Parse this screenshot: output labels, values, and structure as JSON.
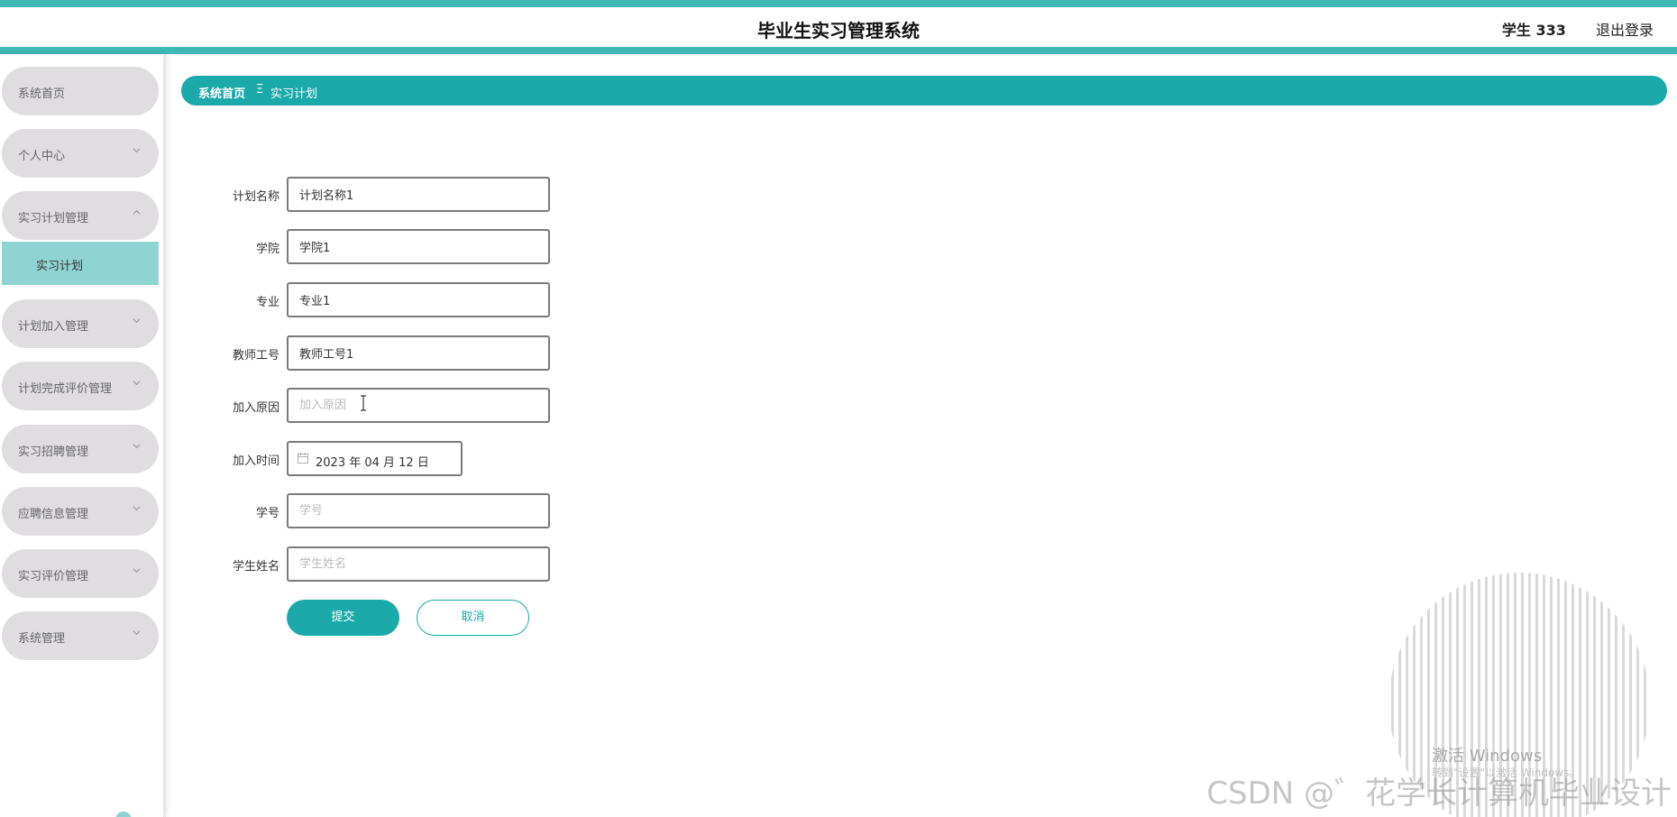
{
  "header": {
    "title": "毕业生实习管理系统",
    "user": "学生 333",
    "logout": "退出登录"
  },
  "sidebar": {
    "items": [
      {
        "label": "系统首页",
        "expandable": false
      },
      {
        "label": "个人中心",
        "expandable": true
      },
      {
        "label": "实习计划管理",
        "expandable": true,
        "expanded": true
      },
      {
        "label": "计划加入管理",
        "expandable": true
      },
      {
        "label": "计划完成评价管理",
        "expandable": true
      },
      {
        "label": "实习招聘管理",
        "expandable": true
      },
      {
        "label": "应聘信息管理",
        "expandable": true
      },
      {
        "label": "实习评价管理",
        "expandable": true
      },
      {
        "label": "系统管理",
        "expandable": true
      }
    ],
    "active_sub_item": "实习计划"
  },
  "breadcrumb": {
    "home": "系统首页",
    "separator": "Ξ",
    "current": "实习计划"
  },
  "form": {
    "fields": [
      {
        "label": "计划名称",
        "value": "计划名称1",
        "placeholder": "计划名称"
      },
      {
        "label": "学院",
        "value": "学院1",
        "placeholder": "学院"
      },
      {
        "label": "专业",
        "value": "专业1",
        "placeholder": "专业"
      },
      {
        "label": "教师工号",
        "value": "教师工号1",
        "placeholder": "教师工号"
      },
      {
        "label": "加入原因",
        "value": "",
        "placeholder": "加入原因"
      },
      {
        "label": "加入时间",
        "value": "2023 年 04 月 12 日"
      },
      {
        "label": "学号",
        "value": "",
        "placeholder": "学号"
      },
      {
        "label": "学生姓名",
        "value": "",
        "placeholder": "学生姓名"
      }
    ],
    "submit_label": "提交",
    "cancel_label": "取消"
  },
  "overlay": {
    "activate_windows": "激活 Windows",
    "activate_windows_hint": "转到\"设置\"以激活 Windows。",
    "watermark": "CSDN @゛花学长计算机毕业设计"
  },
  "colors": {
    "accent": "#1ba9a9",
    "header_border": "#3fb7b2",
    "menu_bg": "#dfdde0",
    "active_sub_bg": "#8fd3d3"
  },
  "icons": {
    "chevron": "chevron-down-icon",
    "chevron_open": "chevron-up-icon",
    "calendar": "calendar-icon",
    "text_cursor": "text-cursor-icon"
  }
}
